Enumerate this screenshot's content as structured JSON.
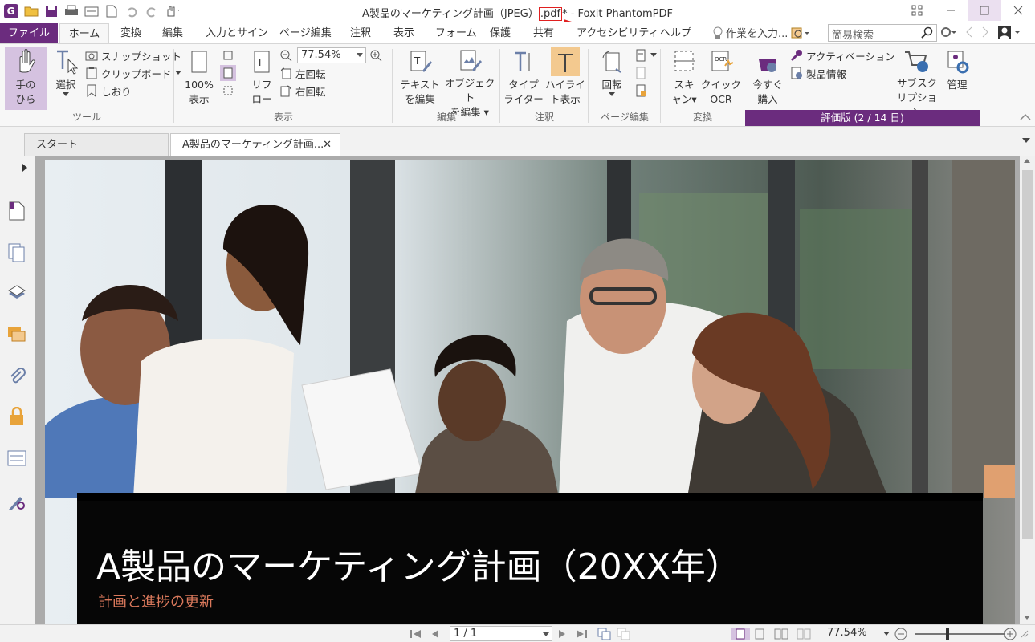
{
  "window": {
    "title_prefix": "A製品のマーケティング計画（JPEG）",
    "title_ext": ".pdf",
    "title_suffix": "* - Foxit PhantomPDF"
  },
  "menu": {
    "file": "ファイル",
    "tabs": [
      "ホーム",
      "変換",
      "編集",
      "入力とサイン",
      "ページ編集",
      "注釈",
      "表示",
      "フォーム",
      "保護",
      "共有",
      "アクセシビリティ",
      "ヘルプ"
    ],
    "hint": "作業を入力...",
    "search_placeholder": "簡易検索"
  },
  "ribbon": {
    "tools": {
      "hand_l1": "手の",
      "hand_l2": "ひら",
      "select": "選択",
      "snapshot": "スナップショット",
      "clipboard": "クリップボード",
      "bookmark": "しおり",
      "group": "ツール"
    },
    "view": {
      "actual_l1": "100%",
      "actual_l2": "表示",
      "reflow_l1": "リフ",
      "reflow_l2": "ロー",
      "zoom": "77.54%",
      "rotate_left": "左回転",
      "rotate_right": "右回転",
      "group": "表示"
    },
    "edit": {
      "text_l1": "テキスト",
      "text_l2": "を編集",
      "obj_l1": "オブジェクト",
      "obj_l2": "を編集",
      "group": "編集"
    },
    "comment": {
      "type_l1": "タイプ",
      "type_l2": "ライター",
      "hl_l1": "ハイライ",
      "hl_l2": "ト表示",
      "group": "注釈"
    },
    "page": {
      "rotate": "回転",
      "group": "ページ編集"
    },
    "convert": {
      "scan_l1": "スキ",
      "scan_l2": "ャン",
      "ocr_l1": "クイック",
      "ocr_l2": "OCR",
      "group": "変換"
    },
    "trial": {
      "buy_l1": "今すぐ",
      "buy_l2": "購入",
      "activation": "アクティベーション",
      "product_info": "製品情報",
      "sub_l1": "サブスク",
      "sub_l2": "リプション",
      "manage": "管理",
      "banner": "評価版 (2 / 14 日)"
    }
  },
  "doc_tabs": {
    "start": "スタート",
    "current": "A製品のマーケティング計画..."
  },
  "document": {
    "title": "A製品のマーケティング計画（20XX年）",
    "subtitle": "計画と進捗の更新"
  },
  "statusbar": {
    "page": "1 / 1",
    "zoom": "77.54%",
    "zoom_level": 0.35
  },
  "colors": {
    "brand": "#6b2c7e",
    "annotation": "#e02020",
    "subtitle": "#d9785b"
  }
}
